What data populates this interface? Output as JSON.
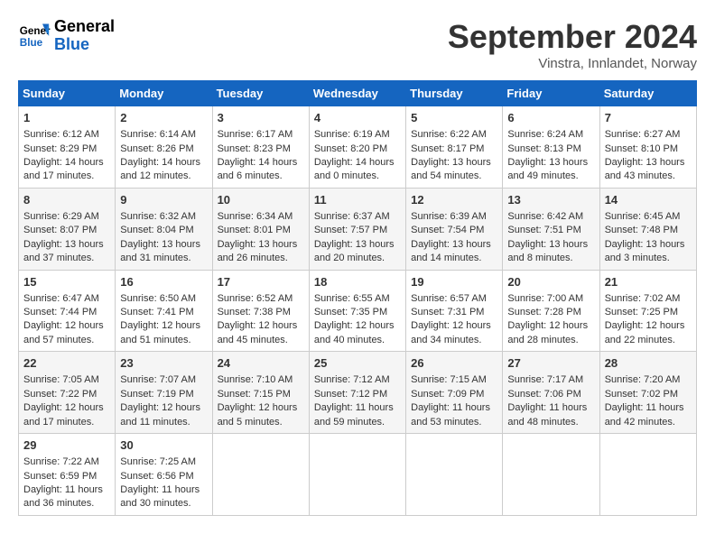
{
  "header": {
    "logo_general": "General",
    "logo_blue": "Blue",
    "month": "September 2024",
    "location": "Vinstra, Innlandet, Norway"
  },
  "days_of_week": [
    "Sunday",
    "Monday",
    "Tuesday",
    "Wednesday",
    "Thursday",
    "Friday",
    "Saturday"
  ],
  "weeks": [
    [
      {
        "day": "1",
        "lines": [
          "Sunrise: 6:12 AM",
          "Sunset: 8:29 PM",
          "Daylight: 14 hours",
          "and 17 minutes."
        ]
      },
      {
        "day": "2",
        "lines": [
          "Sunrise: 6:14 AM",
          "Sunset: 8:26 PM",
          "Daylight: 14 hours",
          "and 12 minutes."
        ]
      },
      {
        "day": "3",
        "lines": [
          "Sunrise: 6:17 AM",
          "Sunset: 8:23 PM",
          "Daylight: 14 hours",
          "and 6 minutes."
        ]
      },
      {
        "day": "4",
        "lines": [
          "Sunrise: 6:19 AM",
          "Sunset: 8:20 PM",
          "Daylight: 14 hours",
          "and 0 minutes."
        ]
      },
      {
        "day": "5",
        "lines": [
          "Sunrise: 6:22 AM",
          "Sunset: 8:17 PM",
          "Daylight: 13 hours",
          "and 54 minutes."
        ]
      },
      {
        "day": "6",
        "lines": [
          "Sunrise: 6:24 AM",
          "Sunset: 8:13 PM",
          "Daylight: 13 hours",
          "and 49 minutes."
        ]
      },
      {
        "day": "7",
        "lines": [
          "Sunrise: 6:27 AM",
          "Sunset: 8:10 PM",
          "Daylight: 13 hours",
          "and 43 minutes."
        ]
      }
    ],
    [
      {
        "day": "8",
        "lines": [
          "Sunrise: 6:29 AM",
          "Sunset: 8:07 PM",
          "Daylight: 13 hours",
          "and 37 minutes."
        ]
      },
      {
        "day": "9",
        "lines": [
          "Sunrise: 6:32 AM",
          "Sunset: 8:04 PM",
          "Daylight: 13 hours",
          "and 31 minutes."
        ]
      },
      {
        "day": "10",
        "lines": [
          "Sunrise: 6:34 AM",
          "Sunset: 8:01 PM",
          "Daylight: 13 hours",
          "and 26 minutes."
        ]
      },
      {
        "day": "11",
        "lines": [
          "Sunrise: 6:37 AM",
          "Sunset: 7:57 PM",
          "Daylight: 13 hours",
          "and 20 minutes."
        ]
      },
      {
        "day": "12",
        "lines": [
          "Sunrise: 6:39 AM",
          "Sunset: 7:54 PM",
          "Daylight: 13 hours",
          "and 14 minutes."
        ]
      },
      {
        "day": "13",
        "lines": [
          "Sunrise: 6:42 AM",
          "Sunset: 7:51 PM",
          "Daylight: 13 hours",
          "and 8 minutes."
        ]
      },
      {
        "day": "14",
        "lines": [
          "Sunrise: 6:45 AM",
          "Sunset: 7:48 PM",
          "Daylight: 13 hours",
          "and 3 minutes."
        ]
      }
    ],
    [
      {
        "day": "15",
        "lines": [
          "Sunrise: 6:47 AM",
          "Sunset: 7:44 PM",
          "Daylight: 12 hours",
          "and 57 minutes."
        ]
      },
      {
        "day": "16",
        "lines": [
          "Sunrise: 6:50 AM",
          "Sunset: 7:41 PM",
          "Daylight: 12 hours",
          "and 51 minutes."
        ]
      },
      {
        "day": "17",
        "lines": [
          "Sunrise: 6:52 AM",
          "Sunset: 7:38 PM",
          "Daylight: 12 hours",
          "and 45 minutes."
        ]
      },
      {
        "day": "18",
        "lines": [
          "Sunrise: 6:55 AM",
          "Sunset: 7:35 PM",
          "Daylight: 12 hours",
          "and 40 minutes."
        ]
      },
      {
        "day": "19",
        "lines": [
          "Sunrise: 6:57 AM",
          "Sunset: 7:31 PM",
          "Daylight: 12 hours",
          "and 34 minutes."
        ]
      },
      {
        "day": "20",
        "lines": [
          "Sunrise: 7:00 AM",
          "Sunset: 7:28 PM",
          "Daylight: 12 hours",
          "and 28 minutes."
        ]
      },
      {
        "day": "21",
        "lines": [
          "Sunrise: 7:02 AM",
          "Sunset: 7:25 PM",
          "Daylight: 12 hours",
          "and 22 minutes."
        ]
      }
    ],
    [
      {
        "day": "22",
        "lines": [
          "Sunrise: 7:05 AM",
          "Sunset: 7:22 PM",
          "Daylight: 12 hours",
          "and 17 minutes."
        ]
      },
      {
        "day": "23",
        "lines": [
          "Sunrise: 7:07 AM",
          "Sunset: 7:19 PM",
          "Daylight: 12 hours",
          "and 11 minutes."
        ]
      },
      {
        "day": "24",
        "lines": [
          "Sunrise: 7:10 AM",
          "Sunset: 7:15 PM",
          "Daylight: 12 hours",
          "and 5 minutes."
        ]
      },
      {
        "day": "25",
        "lines": [
          "Sunrise: 7:12 AM",
          "Sunset: 7:12 PM",
          "Daylight: 11 hours",
          "and 59 minutes."
        ]
      },
      {
        "day": "26",
        "lines": [
          "Sunrise: 7:15 AM",
          "Sunset: 7:09 PM",
          "Daylight: 11 hours",
          "and 53 minutes."
        ]
      },
      {
        "day": "27",
        "lines": [
          "Sunrise: 7:17 AM",
          "Sunset: 7:06 PM",
          "Daylight: 11 hours",
          "and 48 minutes."
        ]
      },
      {
        "day": "28",
        "lines": [
          "Sunrise: 7:20 AM",
          "Sunset: 7:02 PM",
          "Daylight: 11 hours",
          "and 42 minutes."
        ]
      }
    ],
    [
      {
        "day": "29",
        "lines": [
          "Sunrise: 7:22 AM",
          "Sunset: 6:59 PM",
          "Daylight: 11 hours",
          "and 36 minutes."
        ]
      },
      {
        "day": "30",
        "lines": [
          "Sunrise: 7:25 AM",
          "Sunset: 6:56 PM",
          "Daylight: 11 hours",
          "and 30 minutes."
        ]
      },
      {
        "day": "",
        "lines": []
      },
      {
        "day": "",
        "lines": []
      },
      {
        "day": "",
        "lines": []
      },
      {
        "day": "",
        "lines": []
      },
      {
        "day": "",
        "lines": []
      }
    ]
  ]
}
